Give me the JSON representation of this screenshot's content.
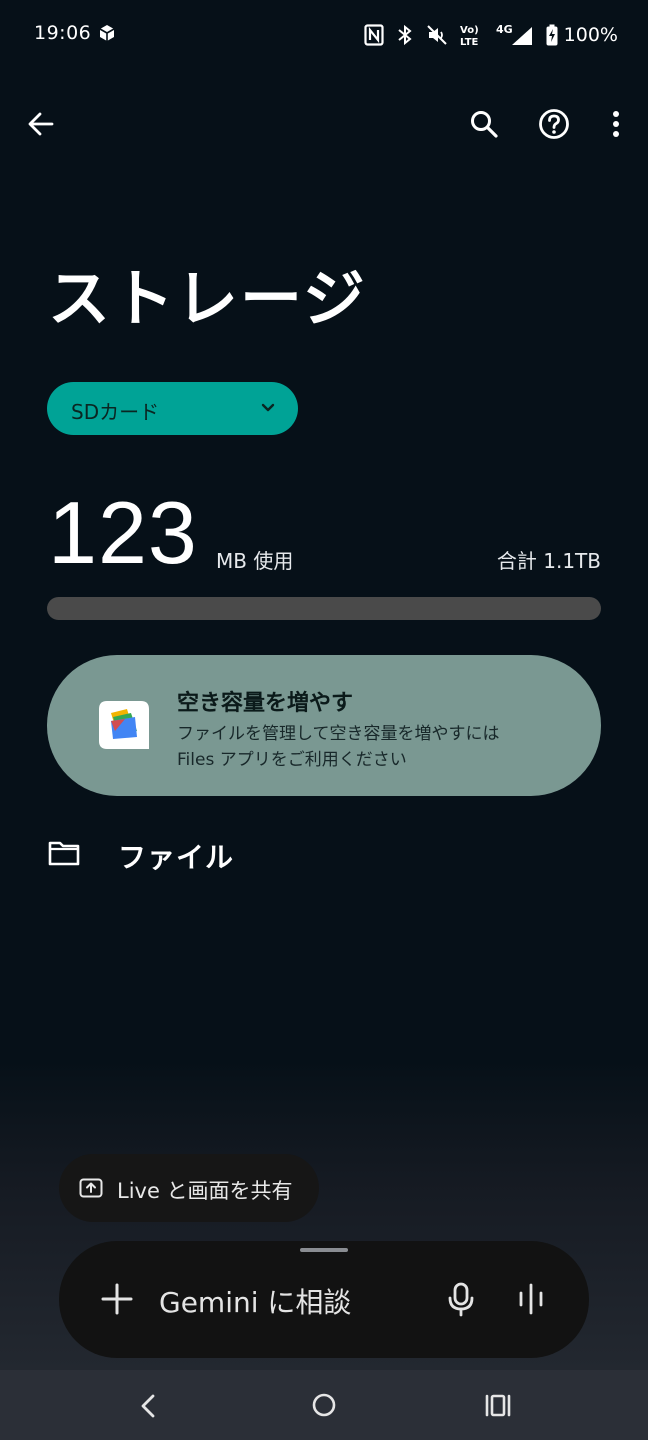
{
  "status_bar": {
    "time": "19:06",
    "battery": "100%",
    "network_top": "Vo)",
    "network_bottom": "LTE",
    "network_gen": "4G",
    "icons": [
      "nfc-icon",
      "bluetooth-icon",
      "vibrate-off-icon",
      "volte-icon",
      "signal-icon",
      "battery-charging-icon"
    ]
  },
  "app_bar": {
    "back_icon": "arrow-back-icon",
    "search_icon": "search-icon",
    "help_icon": "help-circle-icon",
    "more_icon": "more-vert-icon"
  },
  "page": {
    "title": "ストレージ"
  },
  "volume_selector": {
    "selected": "SDカード",
    "icon": "chevron-down-icon"
  },
  "usage": {
    "used_value": "123",
    "used_unit": "MB 使用",
    "total": "合計 1.1TB",
    "fraction_used": 0.0001
  },
  "free_up_card": {
    "title": "空き容量を増やす",
    "description_line1": "ファイルを管理して空き容量を増やすには",
    "description_line2": "Files アプリをご利用ください",
    "icon": "files-app-icon"
  },
  "files_item": {
    "label": "ファイル",
    "icon": "folder-icon"
  },
  "gemini": {
    "live_share_label": "Live と画面を共有",
    "input_placeholder": "Gemini に相談",
    "icons": [
      "screen-share-icon",
      "plus-icon",
      "mic-icon",
      "live-wave-icon"
    ]
  },
  "nav_bar": {
    "icons": [
      "nav-back-icon",
      "nav-home-icon",
      "nav-recents-icon"
    ]
  },
  "colors": {
    "background": "#061018",
    "accent": "#00a396",
    "card": "#7a9892",
    "progress_track": "#4a4a4a"
  }
}
